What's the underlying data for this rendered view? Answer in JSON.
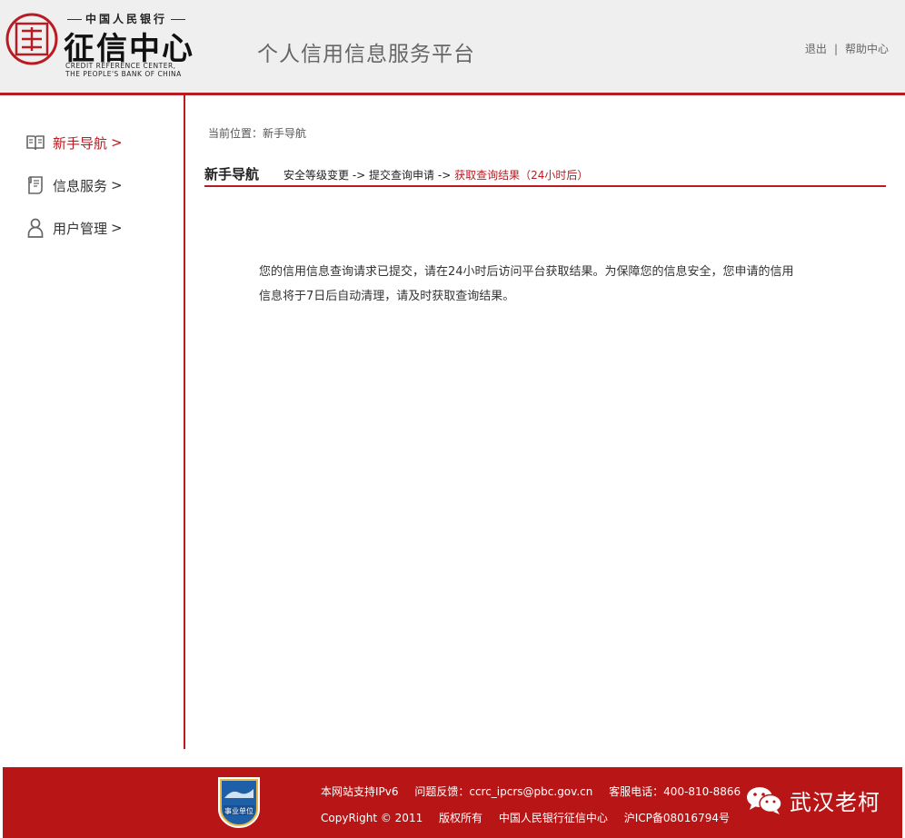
{
  "header": {
    "logo_top": "中国人民银行",
    "logo_main": "征信中心",
    "logo_sub1": "CREDIT REFERENCE CENTER,",
    "logo_sub2": "THE PEOPLE'S BANK OF CHINA",
    "site_title": "个人信用信息服务平台",
    "logout": "退出",
    "separator": "|",
    "help": "帮助中心"
  },
  "sidebar": {
    "items": [
      {
        "label": "新手导航",
        "arrow": ">",
        "icon": "book-icon",
        "active": true
      },
      {
        "label": "信息服务",
        "arrow": ">",
        "icon": "document-icon",
        "active": false
      },
      {
        "label": "用户管理",
        "arrow": ">",
        "icon": "user-icon",
        "active": false
      }
    ]
  },
  "main": {
    "breadcrumb": "当前位置：新手导航",
    "section_title": "新手导航",
    "steps": {
      "step1": "安全等级变更",
      "arrow": " -> ",
      "step2": "提交查询申请",
      "step3": "获取查询结果（24小时后）"
    },
    "notice_line1": "您的信用信息查询请求已提交，请在24小时后访问平台获取结果。为保障您的信息安全，您申请的信用",
    "notice_line2": "信息将于7日后自动清理，请及时获取查询结果。"
  },
  "footer": {
    "badge_text": "事业单位",
    "ipv6": "本网站支持IPv6",
    "feedback": "问题反馈：ccrc_ipcrs@pbc.gov.cn",
    "hotline": "客服电话：400-810-8866",
    "copyright": "CopyRight © 2011",
    "rights": "版权所有",
    "org": "中国人民银行征信中心",
    "icp": "沪ICP备08016794号",
    "watermark": "武汉老柯"
  },
  "colors": {
    "accent": "#b81c22",
    "footer_bg": "#b81516",
    "header_bg": "#efefef"
  }
}
